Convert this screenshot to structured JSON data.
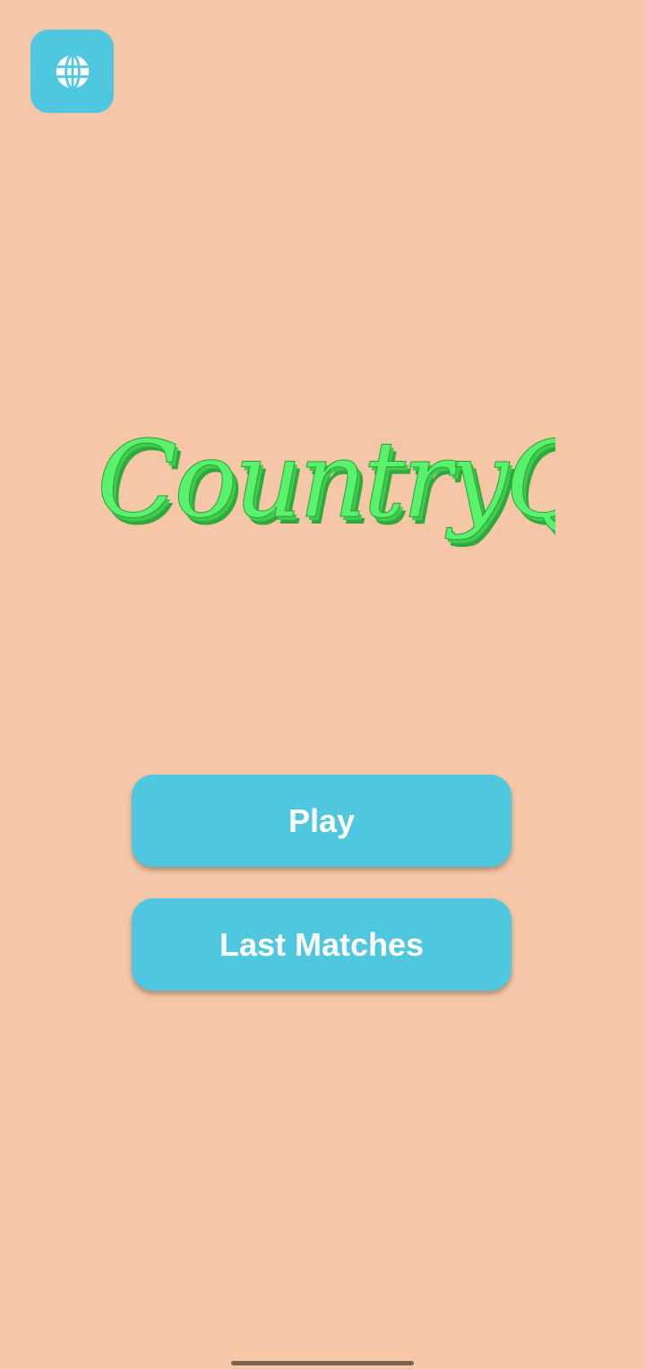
{
  "header": {
    "language_icon": "globe-icon"
  },
  "logo": {
    "text": "CountryQuiz"
  },
  "menu": {
    "play_label": "Play",
    "last_matches_label": "Last Matches"
  },
  "colors": {
    "background": "#F5C7A7",
    "button": "#4EC7DF",
    "button_text": "#FFFFFF",
    "logo_face": "#55F06A",
    "logo_shadow": "#2FA83C"
  }
}
